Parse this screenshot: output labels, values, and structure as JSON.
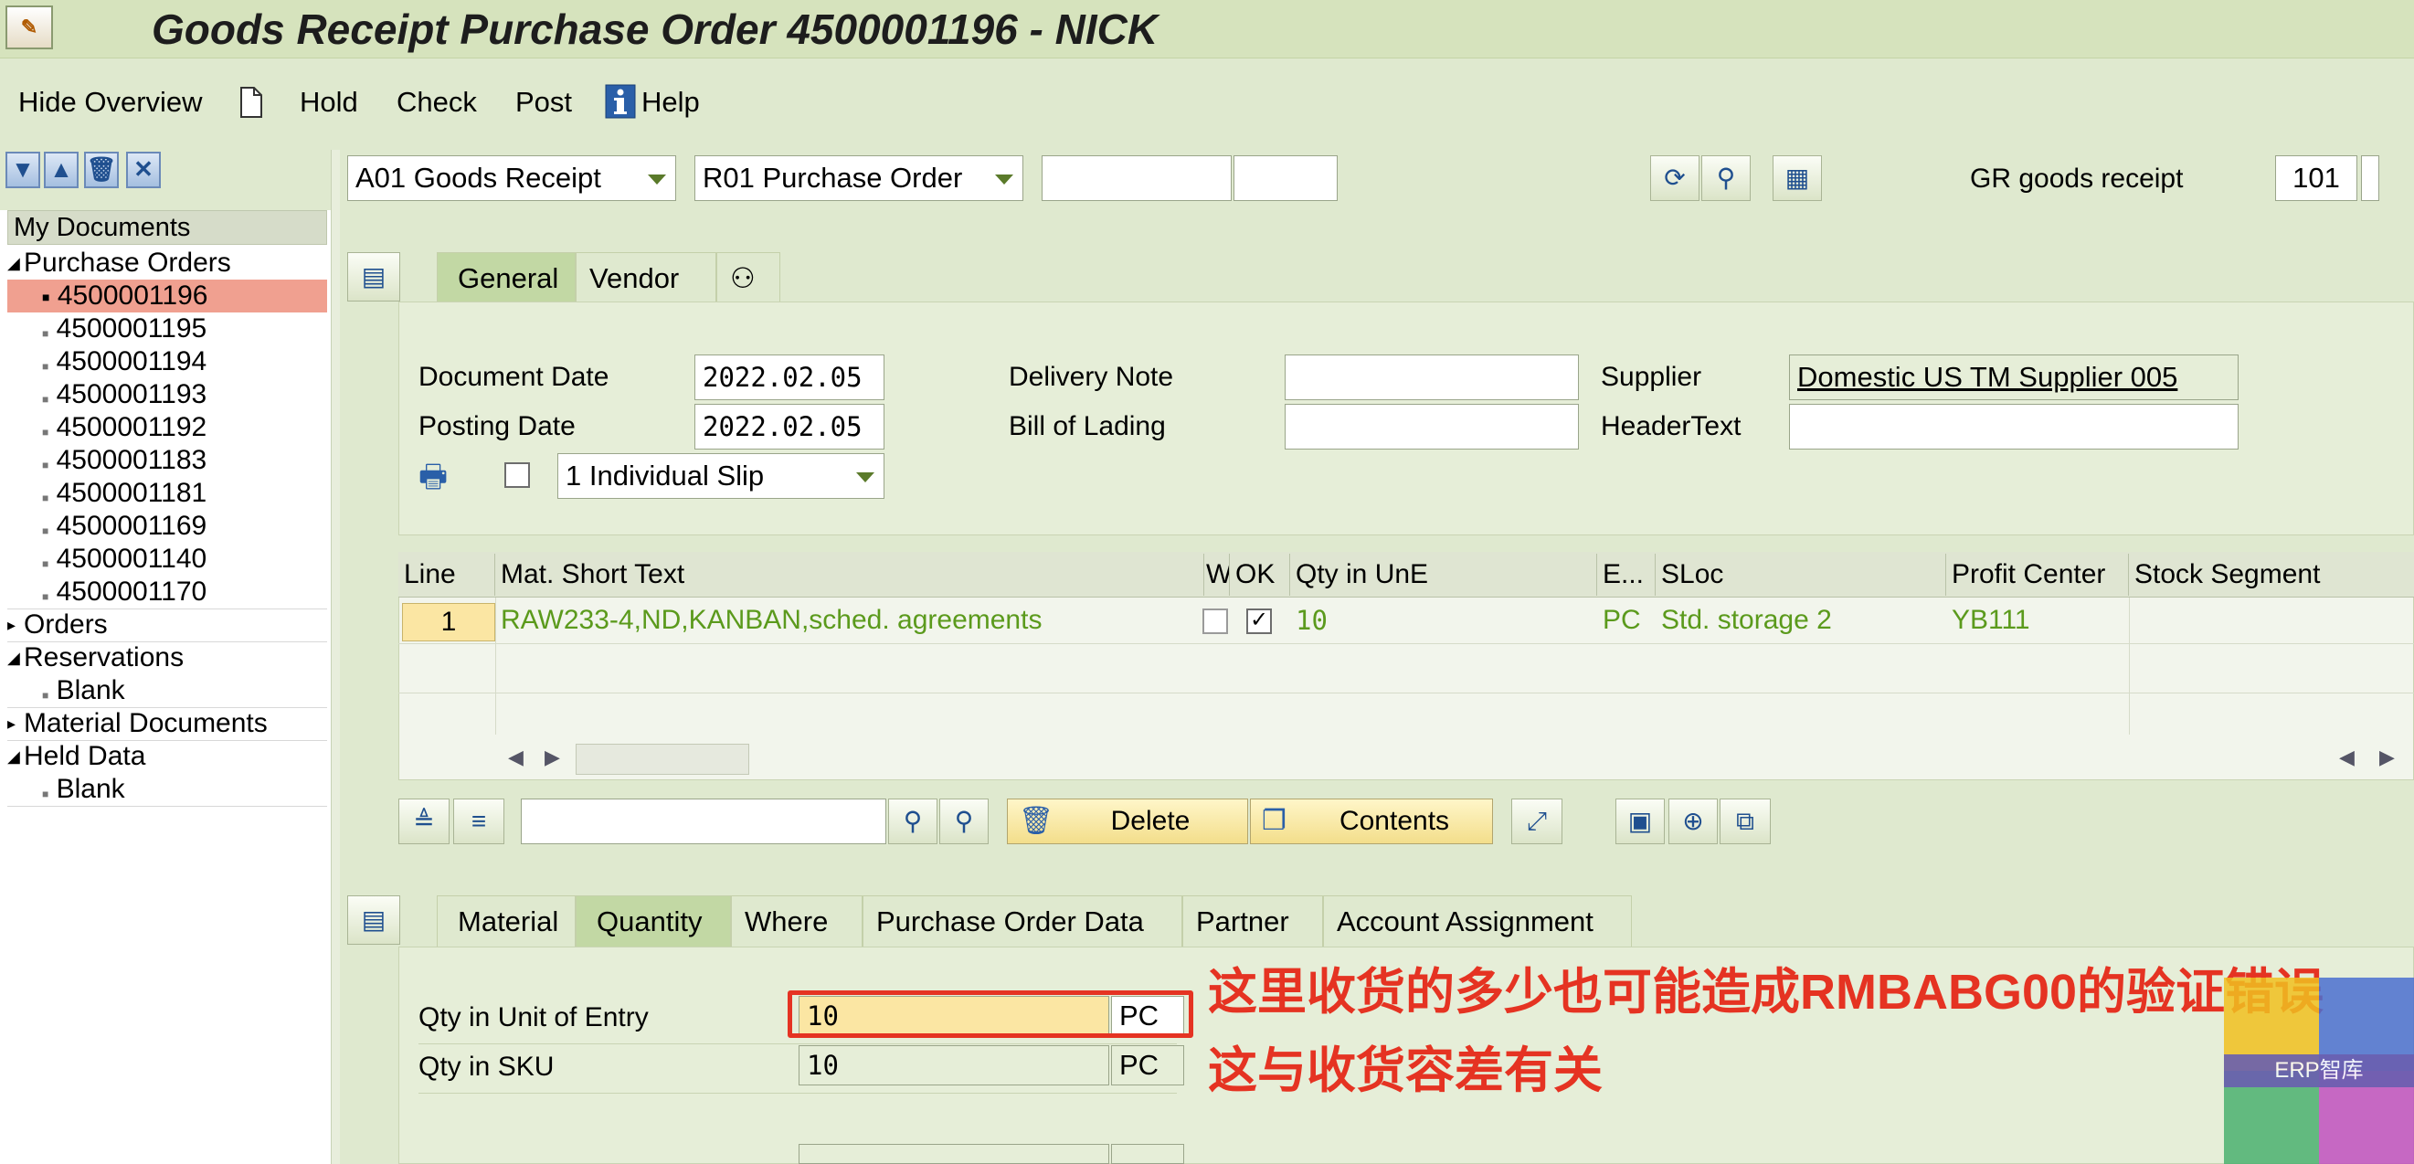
{
  "window": {
    "title": "Goods Receipt Purchase Order 4500001196 - NICK"
  },
  "toolbar": {
    "hide_overview": "Hide Overview",
    "hold": "Hold",
    "check": "Check",
    "post": "Post",
    "help": "Help"
  },
  "nav": {
    "header": "My Documents",
    "purchase_orders": "Purchase Orders",
    "po_items": [
      "4500001196",
      "4500001195",
      "4500001194",
      "4500001193",
      "4500001192",
      "4500001183",
      "4500001181",
      "4500001169",
      "4500001140",
      "4500001170"
    ],
    "orders": "Orders",
    "reservations": "Reservations",
    "reservations_blank": "Blank",
    "material_documents": "Material Documents",
    "held_data": "Held Data",
    "held_blank": "Blank"
  },
  "header_bar": {
    "action": "A01 Goods Receipt",
    "reference": "R01 Purchase Order",
    "ref_doc": "",
    "ref_item": "",
    "movement_label": "GR goods receipt",
    "movement_type": "101"
  },
  "header_tabs": [
    "General",
    "Vendor"
  ],
  "general": {
    "document_date_label": "Document Date",
    "document_date": "2022.02.05",
    "posting_date_label": "Posting Date",
    "posting_date": "2022.02.05",
    "slip": "1 Individual Slip",
    "delivery_note_label": "Delivery Note",
    "delivery_note": "",
    "bill_of_lading_label": "Bill of Lading",
    "bill_of_lading": "",
    "supplier_label": "Supplier",
    "supplier": "Domestic US TM Supplier 005",
    "header_text_label": "HeaderText",
    "header_text": ""
  },
  "items_table": {
    "columns": [
      "Line",
      "Mat. Short Text",
      "W",
      "OK",
      "Qty in UnE",
      "E...",
      "SLoc",
      "Profit Center",
      "Stock Segment"
    ],
    "rows": [
      {
        "line": "1",
        "text": "RAW233-4,ND,KANBAN,sched. agreements",
        "ok": true,
        "qty": "10",
        "unit": "PC",
        "sloc": "Std. storage 2",
        "profit_center": "YB111",
        "stock_segment": ""
      }
    ]
  },
  "item_toolbar": {
    "delete": "Delete",
    "contents": "Contents"
  },
  "detail_tabs": [
    "Material",
    "Quantity",
    "Where",
    "Purchase Order Data",
    "Partner",
    "Account Assignment"
  ],
  "quantity": {
    "qty_entry_label": "Qty in Unit of Entry",
    "qty_entry": "10",
    "qty_entry_unit": "PC",
    "qty_sku_label": "Qty in SKU",
    "qty_sku": "10",
    "qty_sku_unit": "PC"
  },
  "annotation": {
    "line1": "这里收货的多少也可能造成RMBABG00的验证错误",
    "line2": "这与收货容差有关"
  },
  "watermark": "ERP智库"
}
